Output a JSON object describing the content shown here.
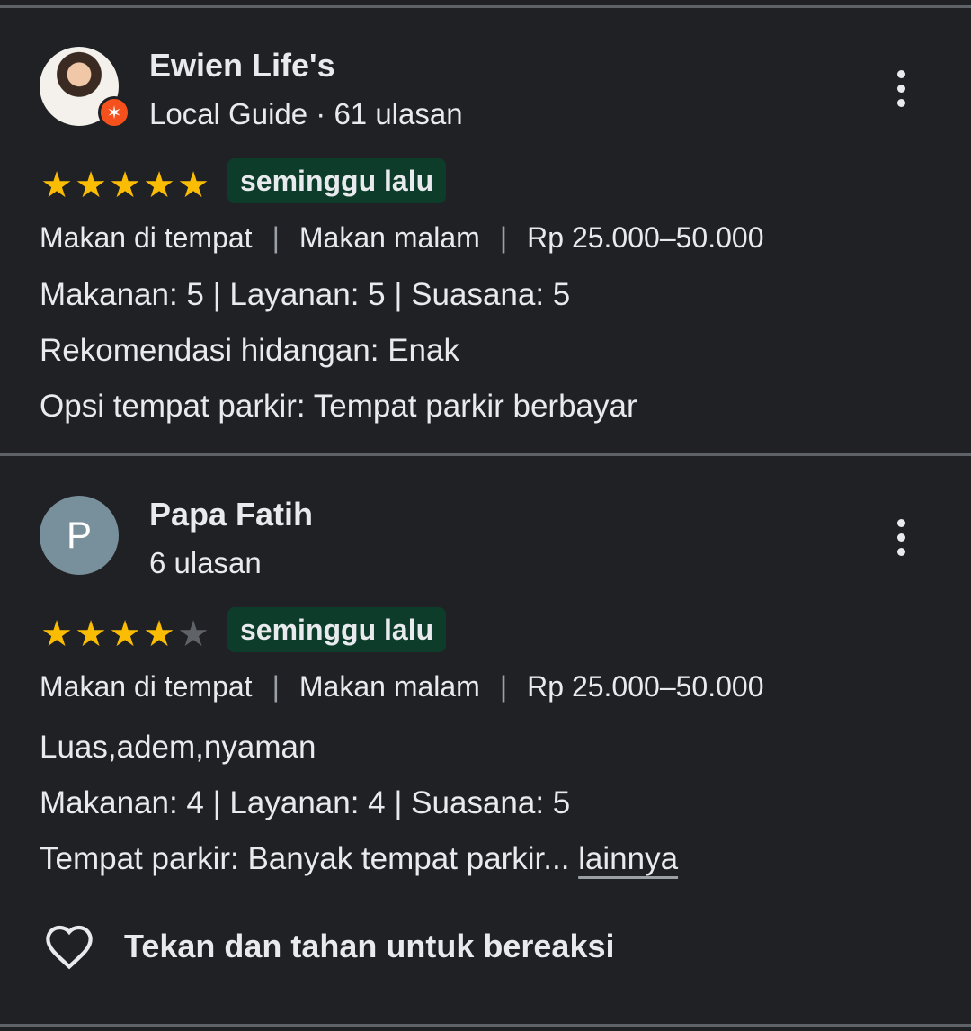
{
  "reviews": [
    {
      "name": "Ewien Life's",
      "meta": "Local Guide · 61 ulasan",
      "avatar_type": "photo",
      "rating": 5,
      "time": "seminggu lalu",
      "tags": [
        "Makan di tempat",
        "Makan malam",
        "Rp 25.000–50.000"
      ],
      "lines": [
        "Makanan: 5 | Layanan: 5 | Suasana: 5",
        "Rekomendasi hidangan: Enak",
        "Opsi tempat parkir: Tempat parkir berbayar"
      ]
    },
    {
      "name": "Papa Fatih",
      "meta": "6 ulasan",
      "avatar_letter": "P",
      "avatar_color": "#78909c",
      "rating": 4,
      "time": "seminggu lalu",
      "tags": [
        "Makan di tempat",
        "Makan malam",
        "Rp 25.000–50.000"
      ],
      "lines": [
        "Luas,adem,nyaman",
        "Makanan: 4 | Layanan: 4 | Suasana: 5"
      ],
      "truncated_line": "Tempat parkir: Banyak tempat parkir...",
      "more_label": "lainnya"
    }
  ],
  "reaction_prompt": "Tekan dan tahan untuk bereaksi",
  "colors": {
    "star": "#fbbc04",
    "time_badge_bg": "#0d3d2a",
    "background": "#202124"
  }
}
